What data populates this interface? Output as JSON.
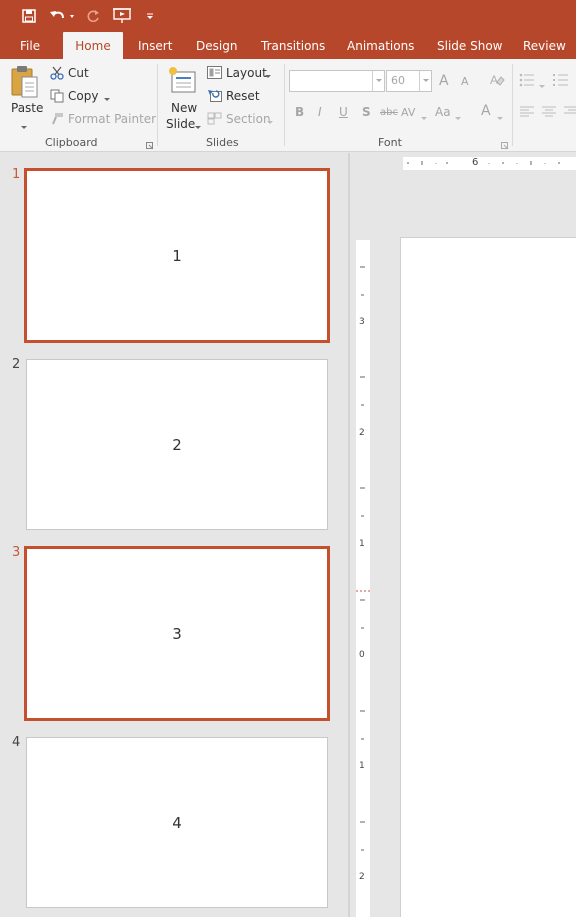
{
  "ribbon_tabs": [
    {
      "label": "File",
      "active": false
    },
    {
      "label": "Home",
      "active": true
    },
    {
      "label": "Insert",
      "active": false
    },
    {
      "label": "Design",
      "active": false
    },
    {
      "label": "Transitions",
      "active": false
    },
    {
      "label": "Animations",
      "active": false
    },
    {
      "label": "Slide Show",
      "active": false
    },
    {
      "label": "Review",
      "active": false
    }
  ],
  "clipboard": {
    "paste": "Paste",
    "cut": "Cut",
    "copy": "Copy",
    "format_painter": "Format Painter",
    "group_label": "Clipboard"
  },
  "slides_group": {
    "new_slide_line1": "New",
    "new_slide_line2": "Slide",
    "layout": "Layout",
    "reset": "Reset",
    "section": "Section",
    "group_label": "Slides"
  },
  "font": {
    "font_name_value": "",
    "font_size_value": "60",
    "group_label": "Font",
    "bold": "B",
    "italic": "I",
    "underline": "U",
    "shadow": "S",
    "strike": "abc",
    "spacing": "AV",
    "case": "Aa",
    "grow": "A",
    "shrink": "A",
    "color": "A"
  },
  "slides": [
    {
      "number": "1",
      "text": "1",
      "selected": true
    },
    {
      "number": "2",
      "text": "2",
      "selected": false
    },
    {
      "number": "3",
      "text": "3",
      "selected": true
    },
    {
      "number": "4",
      "text": "4",
      "selected": false
    }
  ],
  "ruler": {
    "horizontal_label": "6",
    "vertical_labels": [
      "3",
      "2",
      "1",
      "0",
      "1",
      "2"
    ]
  },
  "colors": {
    "accent": "#b7472a",
    "selection": "#c5502e"
  }
}
